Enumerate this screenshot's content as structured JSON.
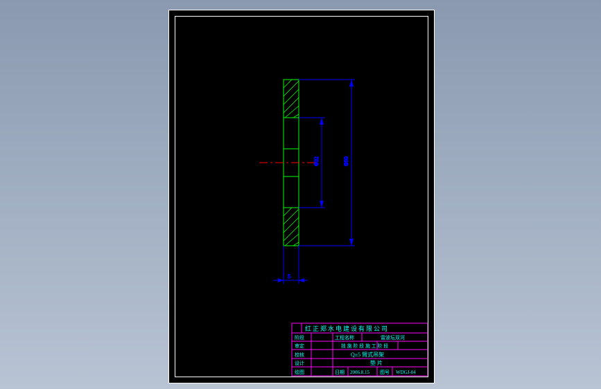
{
  "drawing": {
    "dim_inner": "Φ32",
    "dim_outer": "Φ50",
    "dim_thick": "5"
  },
  "titleblock": {
    "company": "红正郑水电建设有限公司",
    "row1_label": "阶段",
    "row1_proj_label": "工程名称",
    "row1_proj_value": "雷波坛双河",
    "row2_label": "审定",
    "row2_cols": "技 施  阶 段   施 工   阶 段",
    "row3_label": "校核",
    "row3_value": "Q±5 臂式吊架",
    "row4_label": "设计",
    "row4_value": "垫 片",
    "row5_label": "绘图",
    "row5_date_label": "日期",
    "row5_date_value": "2006.8.15",
    "row5_no_label": "图号",
    "row5_no_value": "WDGJ-04"
  }
}
